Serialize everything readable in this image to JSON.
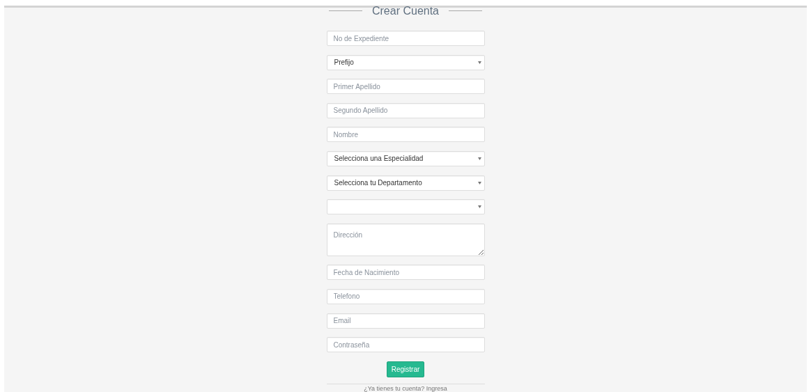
{
  "title": "Crear Cuenta",
  "fields": [
    {
      "kind": "input",
      "placeholder": "No de Expediente"
    },
    {
      "kind": "select",
      "value": "Prefijo"
    },
    {
      "kind": "input",
      "placeholder": "Primer Apellido"
    },
    {
      "kind": "input",
      "placeholder": "Segundo Apellido"
    },
    {
      "kind": "input",
      "placeholder": "Nombre"
    },
    {
      "kind": "select",
      "value": "Selecciona una Especialidad"
    },
    {
      "kind": "select",
      "value": "Selecciona tu Departamento"
    },
    {
      "kind": "select"
    },
    {
      "kind": "textarea",
      "placeholder": "Dirección"
    },
    {
      "kind": "input",
      "placeholder": "Fecha de Nacimiento"
    },
    {
      "kind": "input",
      "placeholder": "Telefono"
    },
    {
      "kind": "input",
      "placeholder": "Email"
    },
    {
      "kind": "input",
      "placeholder": "Contraseña"
    }
  ],
  "submit": "Registrar",
  "login_prompt": "¿Ya tienes tu cuenta? Ingresa"
}
